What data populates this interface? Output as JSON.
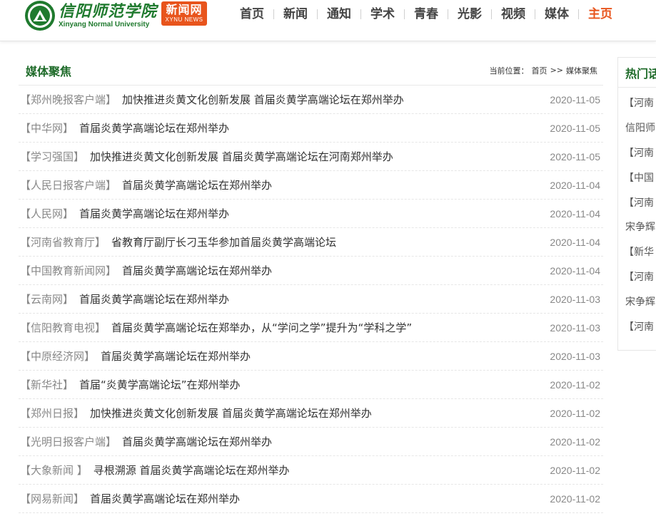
{
  "header": {
    "logo": {
      "cn": "信阳师范学院",
      "en": "Xinyang Normal University",
      "badge_cn": "新闻网",
      "badge_en": "XYNU NEWS"
    },
    "nav": [
      {
        "label": "首页",
        "active": false
      },
      {
        "label": "新闻",
        "active": false
      },
      {
        "label": "通知",
        "active": false
      },
      {
        "label": "学术",
        "active": false
      },
      {
        "label": "青春",
        "active": false
      },
      {
        "label": "光影",
        "active": false
      },
      {
        "label": "视频",
        "active": false
      },
      {
        "label": "媒体",
        "active": false
      },
      {
        "label": "主页",
        "active": true
      }
    ]
  },
  "main": {
    "title": "媒体聚焦",
    "breadcrumb": {
      "prefix": "当前位置：",
      "home": "首页",
      "sep": ">>",
      "current": "媒体聚焦"
    },
    "items": [
      {
        "source": "【郑州晚报客户端】",
        "title": "加快推进炎黄文化创新发展 首届炎黄学高端论坛在郑州举办",
        "date": "2020-11-05"
      },
      {
        "source": "【中华网】",
        "title": "首届炎黄学高端论坛在郑州举办",
        "date": "2020-11-05"
      },
      {
        "source": "【学习强国】",
        "title": "加快推进炎黄文化创新发展 首届炎黄学高端论坛在河南郑州举办",
        "date": "2020-11-05"
      },
      {
        "source": "【人民日报客户端】",
        "title": "首届炎黄学高端论坛在郑州举办",
        "date": "2020-11-04"
      },
      {
        "source": "【人民网】",
        "title": "首届炎黄学高端论坛在郑州举办",
        "date": "2020-11-04"
      },
      {
        "source": "【河南省教育厅】",
        "title": "省教育厅副厅长刁玉华参加首届炎黄学高端论坛",
        "date": "2020-11-04"
      },
      {
        "source": "【中国教育新闻网】",
        "title": "首届炎黄学高端论坛在郑州举办",
        "date": "2020-11-04"
      },
      {
        "source": "【云南网】",
        "title": "首届炎黄学高端论坛在郑州举办",
        "date": "2020-11-03"
      },
      {
        "source": "【信阳教育电视】",
        "title": "首届炎黄学高端论坛在郑举办，从“学问之学”提升为“学科之学”",
        "date": "2020-11-03"
      },
      {
        "source": "【中原经济网】",
        "title": "首届炎黄学高端论坛在郑州举办",
        "date": "2020-11-03"
      },
      {
        "source": "【新华社】",
        "title": "首届“炎黄学高端论坛”在郑州举办",
        "date": "2020-11-02"
      },
      {
        "source": "【郑州日报】",
        "title": "加快推进炎黄文化创新发展 首届炎黄学高端论坛在郑州举办",
        "date": "2020-11-02"
      },
      {
        "source": "【光明日报客户端】",
        "title": "首届炎黄学高端论坛在郑州举办",
        "date": "2020-11-02"
      },
      {
        "source": "【大象新闻 】",
        "title": "寻根溯源 首届炎黄学高端论坛在郑州举办",
        "date": "2020-11-02"
      },
      {
        "source": "【网易新闻】",
        "title": "首届炎黄学高端论坛在郑州举办",
        "date": "2020-11-02"
      }
    ]
  },
  "sidebar": {
    "title": "热门话",
    "items": [
      "【河南",
      "信阳师",
      "【河南",
      "【中国",
      "【河南",
      "宋争辉",
      "【新华",
      "【河南",
      "宋争辉",
      "【河南"
    ]
  }
}
